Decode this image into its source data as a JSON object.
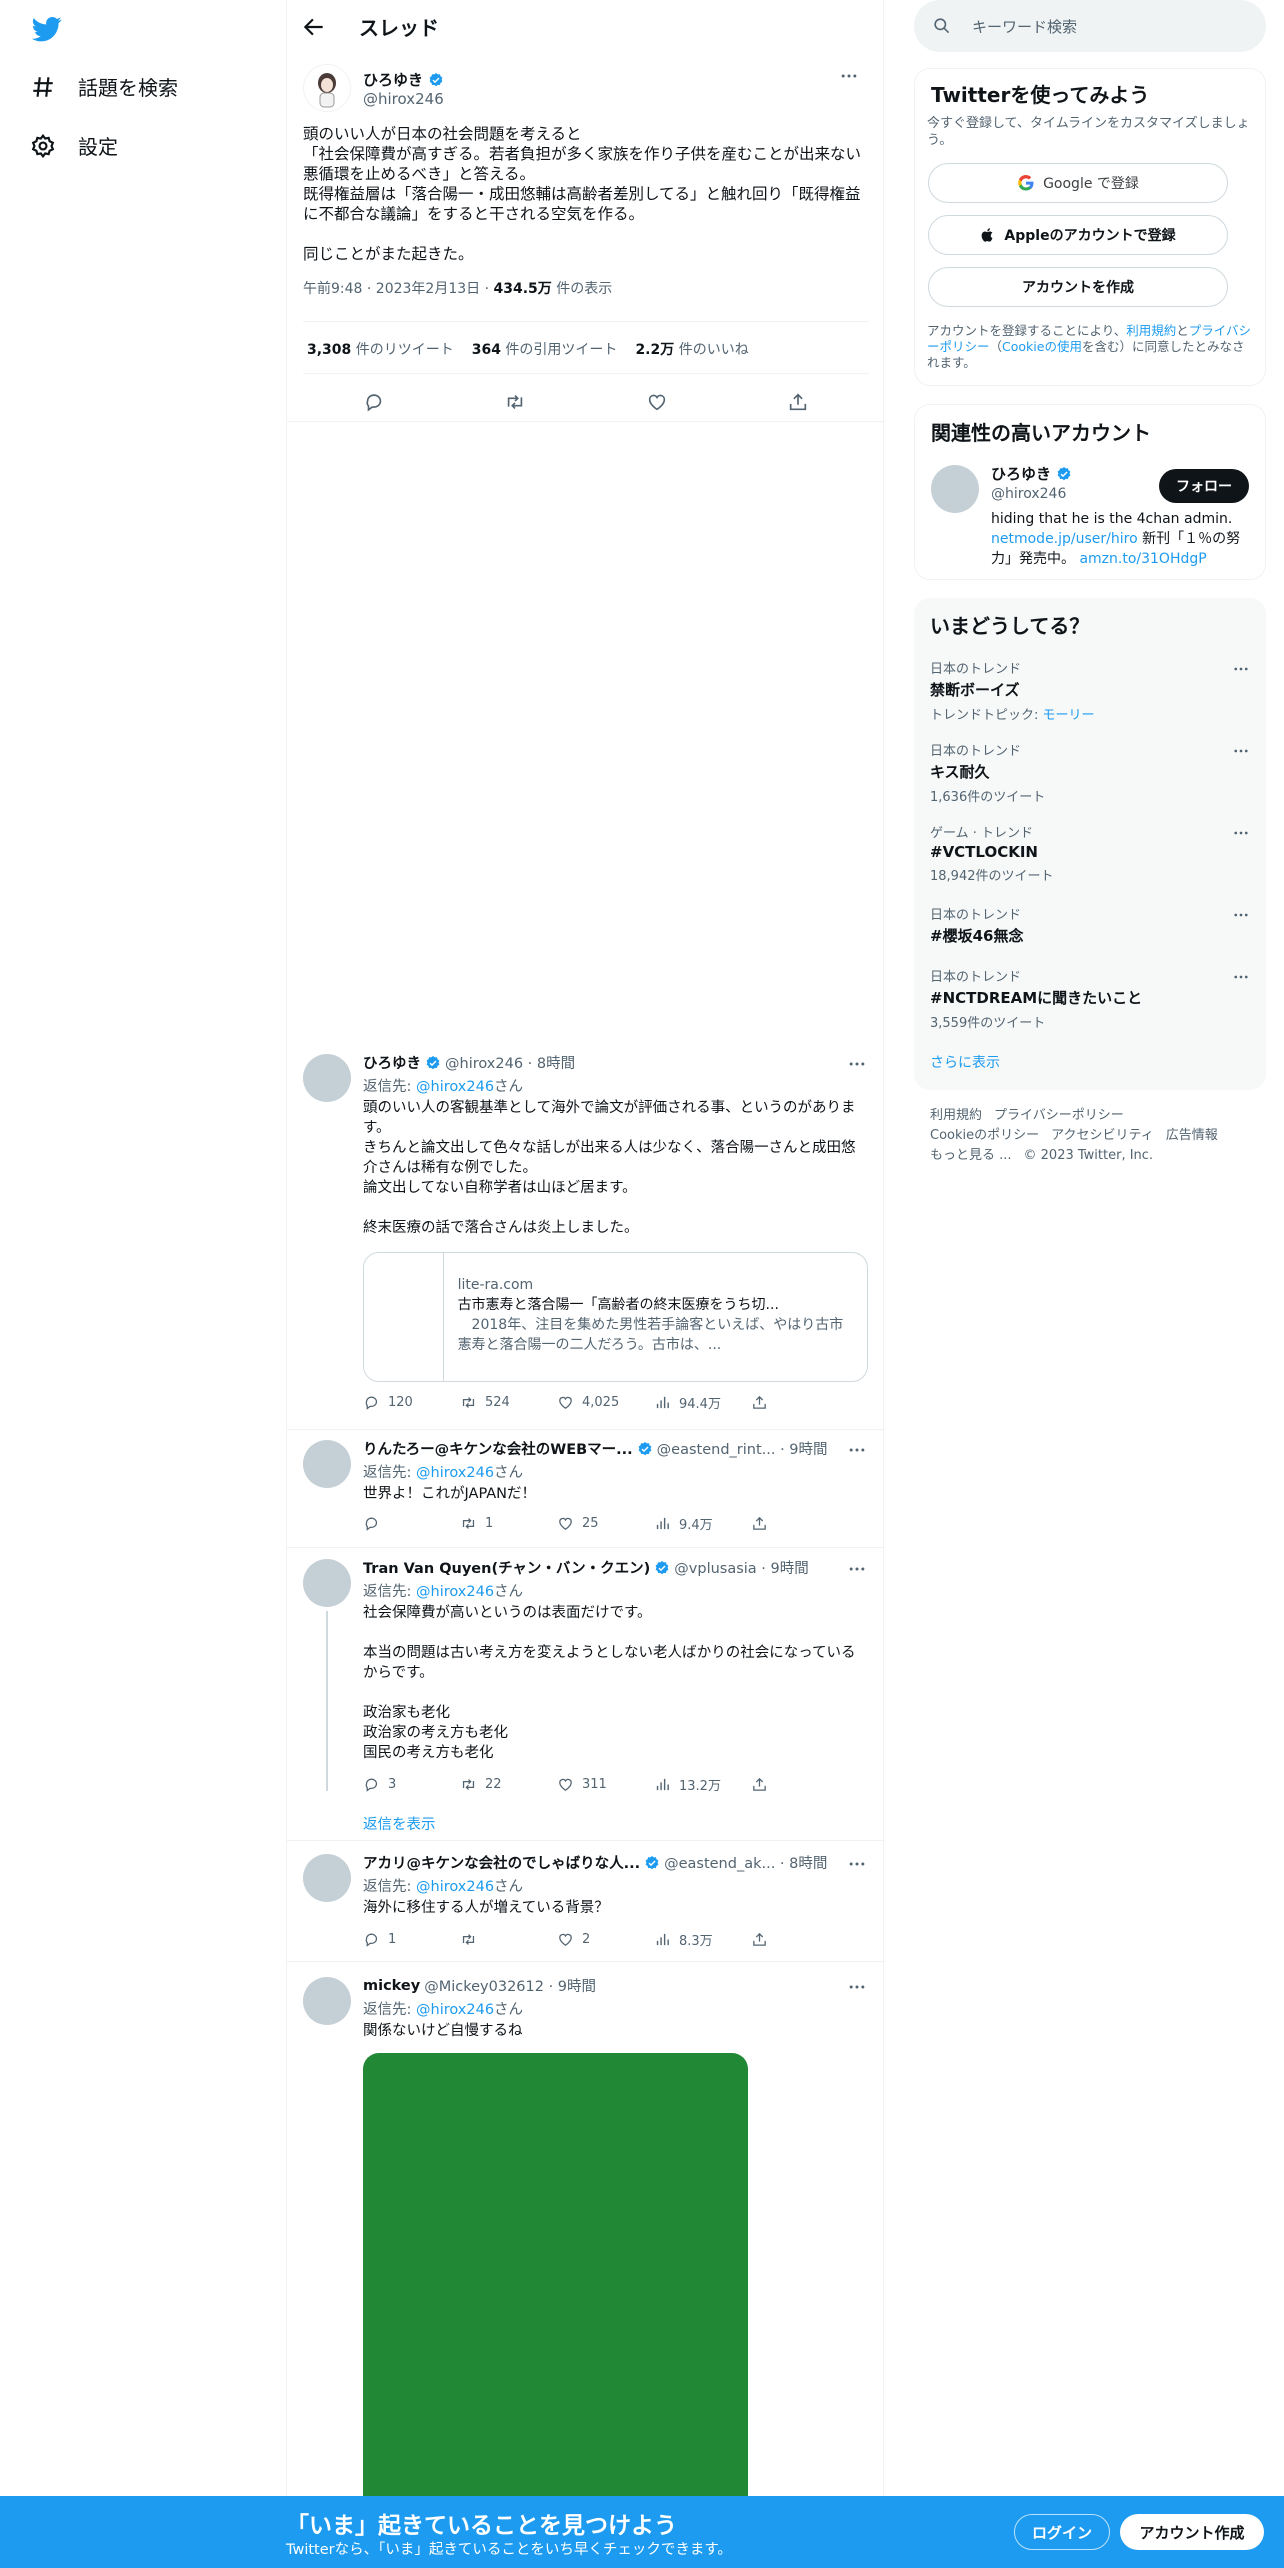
{
  "nav": {
    "explore_label": "話題を検索",
    "settings_label": "設定"
  },
  "header": {
    "title": "スレッド"
  },
  "main_tweet": {
    "name": "ひろゆき",
    "handle": "@hirox246",
    "text": "頭のいい人が日本の社会問題を考えると\n「社会保障費が高すぎる。若者負担が多く家族を作り子供を産むことが出来ない悪循環を止めるべき」と答える。\n既得権益層は「落合陽一・成田悠輔は高齢者差別してる」と触れ回り「既得権益に不都合な議論」をすると干される空気を作る。\n\n同じことがまた起きた。",
    "time": "午前9:48 · 2023年2月13日 · ",
    "views_value": "434.5万",
    "views_label": " 件の表示",
    "retweets_value": "3,308",
    "retweets_label": " 件のリツイート",
    "quotes_value": "364",
    "quotes_label": " 件の引用ツイート",
    "likes_value": "2.2万",
    "likes_label": " 件のいいね"
  },
  "replies": [
    {
      "name": "ひろゆき",
      "handle_time": "@hirox246 · 8時間",
      "reply_to_prefix": "返信先: ",
      "reply_to": "@hirox246",
      "reply_to_suffix": "さん",
      "text": "頭のいい人の客観基準として海外で論文が評価される事、というのがあります。\nきちんと論文出して色々な話しが出来る人は少なく、落合陽一さんと成田悠介さんは稀有な例でした。\n論文出してない自称学者は山ほど居ます。\n\n終末医療の話で落合さんは炎上しました。",
      "card_domain": "lite-ra.com",
      "card_title": "古市憲寿と落合陽一「高齢者の終末医療をうち切...",
      "card_desc": "　2018年、注目を集めた男性若手論客といえば、やはり古市憲寿と落合陽一の二人だろう。古市は、...",
      "replies": "120",
      "retweets": "524",
      "likes": "4,025",
      "views": "94.4万"
    },
    {
      "name": "りんたろー@キケンな会社のWEBマー...",
      "handle_time": "@eastend_rint... · 9時間",
      "reply_to_prefix": "返信先: ",
      "reply_to": "@hirox246",
      "reply_to_suffix": "さん",
      "text": "世界よ！これがJAPANだ！",
      "replies": "",
      "retweets": "1",
      "likes": "25",
      "views": "9.4万"
    },
    {
      "name": "Tran Van Quyen(チャン・バン・クエン)",
      "handle_time": "@vplusasia · 9時間",
      "reply_to_prefix": "返信先: ",
      "reply_to": "@hirox246",
      "reply_to_suffix": "さん",
      "text": "社会保障費が高いというのは表面だけです。\n\n本当の問題は古い考え方を変えようとしない老人ばかりの社会になっているからです。\n\n政治家も老化\n政治家の考え方も老化\n国民の考え方も老化",
      "replies": "3",
      "retweets": "22",
      "likes": "311",
      "views": "13.2万",
      "show_replies": "返信を表示"
    },
    {
      "name": "アカリ@キケンな会社のでしゃばりな人...",
      "handle_time": "@eastend_ak... · 8時間",
      "reply_to_prefix": "返信先: ",
      "reply_to": "@hirox246",
      "reply_to_suffix": "さん",
      "text": "海外に移住する人が増えている背景？",
      "replies": "1",
      "retweets": "",
      "likes": "2",
      "views": "8.3万"
    },
    {
      "name": "mickey",
      "handle_time": "@Mickey032612 · 9時間",
      "reply_to_prefix": "返信先: ",
      "reply_to": "@hirox246",
      "reply_to_suffix": "さん",
      "text": "関係ないけど自慢するね"
    }
  ],
  "right": {
    "search_placeholder": "キーワード検索",
    "signup_box": {
      "title": "Twitterを使ってみよう",
      "subtitle": "今すぐ登録して、タイムラインをカスタマイズしましょう。",
      "google_label": "Google で登録",
      "apple_label": "Appleのアカウントで登録",
      "create_label": "アカウントを作成",
      "terms_prefix": "アカウントを登録することにより、",
      "terms_link": "利用規約",
      "terms_and": "と",
      "privacy_link": "プライバシーポリシー",
      "cookie_prefix": "（",
      "cookie_link": "Cookieの使用",
      "terms_suffix": "を含む）に同意したとみなされます。"
    },
    "related": {
      "title": "関連性の高いアカウント",
      "name": "ひろゆき",
      "handle": "@hirox246",
      "follow_label": "フォロー",
      "bio_line1": "hiding that he is the 4chan admin.",
      "bio_link1": "netmode.jp/user/hiro",
      "bio_mid": " 新刊「１％の努力」発売中。 ",
      "bio_link2": "amzn.to/31OHdgP"
    },
    "trends": {
      "title": "いまどうしてる？",
      "items": [
        {
          "context": "日本のトレンド",
          "name": "禁断ボーイズ",
          "extra_prefix": "トレンドトピック: ",
          "extra_link": "モーリー"
        },
        {
          "context": "日本のトレンド",
          "name": "キス耐久",
          "count": "1,636件のツイート"
        },
        {
          "context": "ゲーム · トレンド",
          "name": "#VCTLOCKIN",
          "count": "18,942件のツイート"
        },
        {
          "context": "日本のトレンド",
          "name": "#櫻坂46無念"
        },
        {
          "context": "日本のトレンド",
          "name": "#NCTDREAMに聞きたいこと",
          "count": "3,559件のツイート"
        }
      ],
      "show_more": "さらに表示"
    },
    "footer": {
      "links1": [
        "利用規約",
        "プライバシーポリシー"
      ],
      "links2": [
        "Cookieのポリシー",
        "アクセシビリティ",
        "広告情報"
      ],
      "more": "もっと見る ...",
      "copyright": "© 2023 Twitter, Inc."
    }
  },
  "bottombar": {
    "headline": "「いま」起きていることを見つけよう",
    "sub": "Twitterなら、「いま」起きていることをいち早くチェックできます。",
    "login_label": "ログイン",
    "signup_label": "アカウント作成"
  },
  "colors": {
    "accent": "#1d9bf0",
    "media_green": "#218835"
  }
}
